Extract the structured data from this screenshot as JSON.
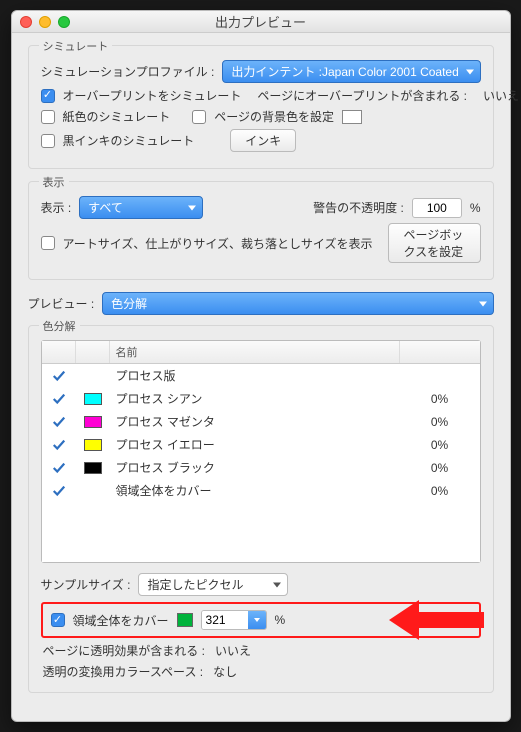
{
  "window": {
    "title": "出力プレビュー"
  },
  "simulate": {
    "group_label": "シミュレート",
    "profile_label": "シミュレーションプロファイル :",
    "profile_value": "出力インテント :Japan Color 2001 Coated",
    "overprint_label": "オーバープリントをシミュレート",
    "page_overprint_label": "ページにオーバープリントが含まれる :",
    "page_overprint_value": "いいえ",
    "paper_label": "紙色のシミュレート",
    "bgcolor_label": "ページの背景色を設定",
    "blackink_label": "黒インキのシミュレート",
    "ink_button": "インキ"
  },
  "display": {
    "group_label": "表示",
    "display_label": "表示 :",
    "display_value": "すべて",
    "warning_opacity_label": "警告の不透明度 :",
    "warning_opacity_value": "100",
    "percent": "%",
    "artsize_label": "アートサイズ、仕上がりサイズ、裁ち落としサイズを表示",
    "pagebox_button": "ページボックスを設定"
  },
  "preview": {
    "label": "プレビュー :",
    "value": "色分解"
  },
  "separations": {
    "group_label": "色分解",
    "header_name": "名前",
    "rows": [
      {
        "name": "プロセス版",
        "color": null,
        "value": ""
      },
      {
        "name": "プロセス シアン",
        "color": "#00ffff",
        "value": "0%"
      },
      {
        "name": "プロセス マゼンタ",
        "color": "#ff00d4",
        "value": "0%"
      },
      {
        "name": "プロセス イエロー",
        "color": "#ffff00",
        "value": "0%"
      },
      {
        "name": "プロセス ブラック",
        "color": "#000000",
        "value": "0%"
      },
      {
        "name": "領域全体をカバー",
        "color": null,
        "value": "0%"
      }
    ]
  },
  "sample": {
    "label": "サンプルサイズ :",
    "value": "指定したピクセル"
  },
  "coverage": {
    "label": "領域全体をカバー",
    "swatch": "#00b33c",
    "value": "321",
    "percent": "%"
  },
  "footer": {
    "transparency_label": "ページに透明効果が含まれる :",
    "transparency_value": "いいえ",
    "colorspace_label": "透明の変換用カラースペース :",
    "colorspace_value": "なし"
  }
}
